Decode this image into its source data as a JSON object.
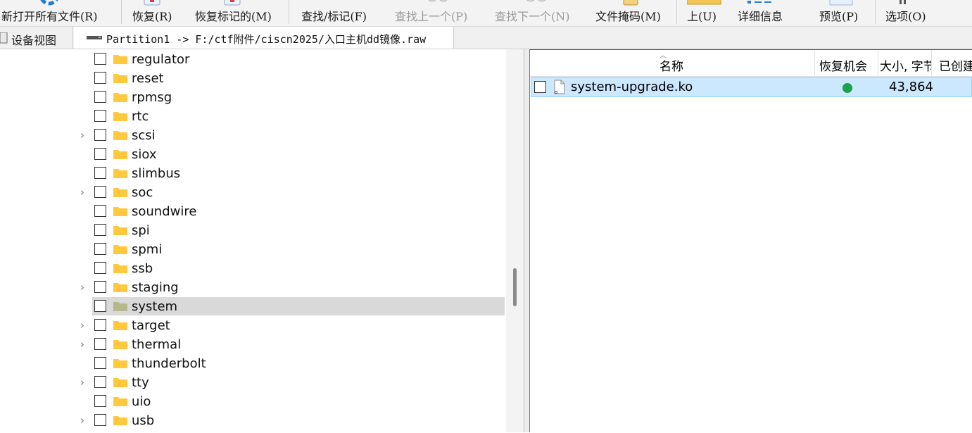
{
  "toolbar": {
    "open_all": "新打开所有文件(R)",
    "recover": "恢复(R)",
    "recover_marked": "恢复标记的(M)",
    "find_mark": "查找/标记(F)",
    "find_prev": "查找上一个(P)",
    "find_next": "查找下一个(N)",
    "file_mask": "文件掩码(M)",
    "up": "上(U)",
    "details": "详细信息",
    "preview": "预览(P)",
    "options": "选项(O)"
  },
  "tabs": {
    "device_view": "设备视图",
    "partition": "Partition1 -> F:/ctf附件/ciscn2025/入口主机dd镜像.raw"
  },
  "tree": {
    "items": [
      {
        "label": "regulator",
        "expandable": false
      },
      {
        "label": "reset",
        "expandable": false
      },
      {
        "label": "rpmsg",
        "expandable": false
      },
      {
        "label": "rtc",
        "expandable": false
      },
      {
        "label": "scsi",
        "expandable": true
      },
      {
        "label": "siox",
        "expandable": false
      },
      {
        "label": "slimbus",
        "expandable": false
      },
      {
        "label": "soc",
        "expandable": true
      },
      {
        "label": "soundwire",
        "expandable": false
      },
      {
        "label": "spi",
        "expandable": false
      },
      {
        "label": "spmi",
        "expandable": false
      },
      {
        "label": "ssb",
        "expandable": false
      },
      {
        "label": "staging",
        "expandable": true
      },
      {
        "label": "system",
        "expandable": false,
        "selected": true
      },
      {
        "label": "target",
        "expandable": true
      },
      {
        "label": "thermal",
        "expandable": true
      },
      {
        "label": "thunderbolt",
        "expandable": false
      },
      {
        "label": "tty",
        "expandable": true
      },
      {
        "label": "uio",
        "expandable": false
      },
      {
        "label": "usb",
        "expandable": true
      }
    ]
  },
  "list": {
    "columns": {
      "name": "名称",
      "recover_chance": "恢复机会",
      "size": "大小, 字节",
      "created": "已创建"
    },
    "rows": [
      {
        "name": "system-upgrade.ko",
        "recover_status": "good",
        "size": "43,864"
      }
    ]
  },
  "colors": {
    "folder": "#ffc83d",
    "folder_selected": "#b5b98a",
    "selection": "#cce8ff",
    "recover_good": "#1aa34a"
  },
  "icons": {
    "tab_device": "drive-icon",
    "tab_partition": "partition-icon",
    "folder": "folder-icon",
    "file": "file-icon",
    "expander": "chevron-right-icon"
  }
}
